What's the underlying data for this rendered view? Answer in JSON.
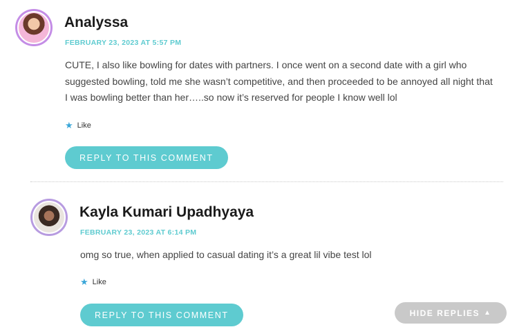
{
  "comments": [
    {
      "author": "Analyssa",
      "date": "FEBRUARY 23, 2023 AT 5:57 PM",
      "text": "CUTE, I also like bowling for dates with partners. I once went on a second date with a girl who suggested bowling, told me she wasn’t competitive, and then proceeded to be annoyed all night that I was bowling better than her…..so now it’s reserved for people I know well lol",
      "like_label": "Like",
      "reply_label": "REPLY TO THIS COMMENT",
      "avatar_icon": "user-avatar"
    },
    {
      "author": "Kayla Kumari Upadhyaya",
      "date": "FEBRUARY 23, 2023 AT 6:14 PM",
      "text": "omg so true, when applied to casual dating it’s a great lil vibe test lol",
      "like_label": "Like",
      "reply_label": "REPLY TO THIS COMMENT",
      "avatar_icon": "user-avatar"
    }
  ],
  "hide_replies_label": "HIDE REPLIES",
  "colors": {
    "accent": "#5ecbd0",
    "like_star": "#3aa6d8",
    "hide_button": "#c9c9c9"
  },
  "icons": {
    "like": "star-icon",
    "hide": "triangle-up-icon"
  }
}
